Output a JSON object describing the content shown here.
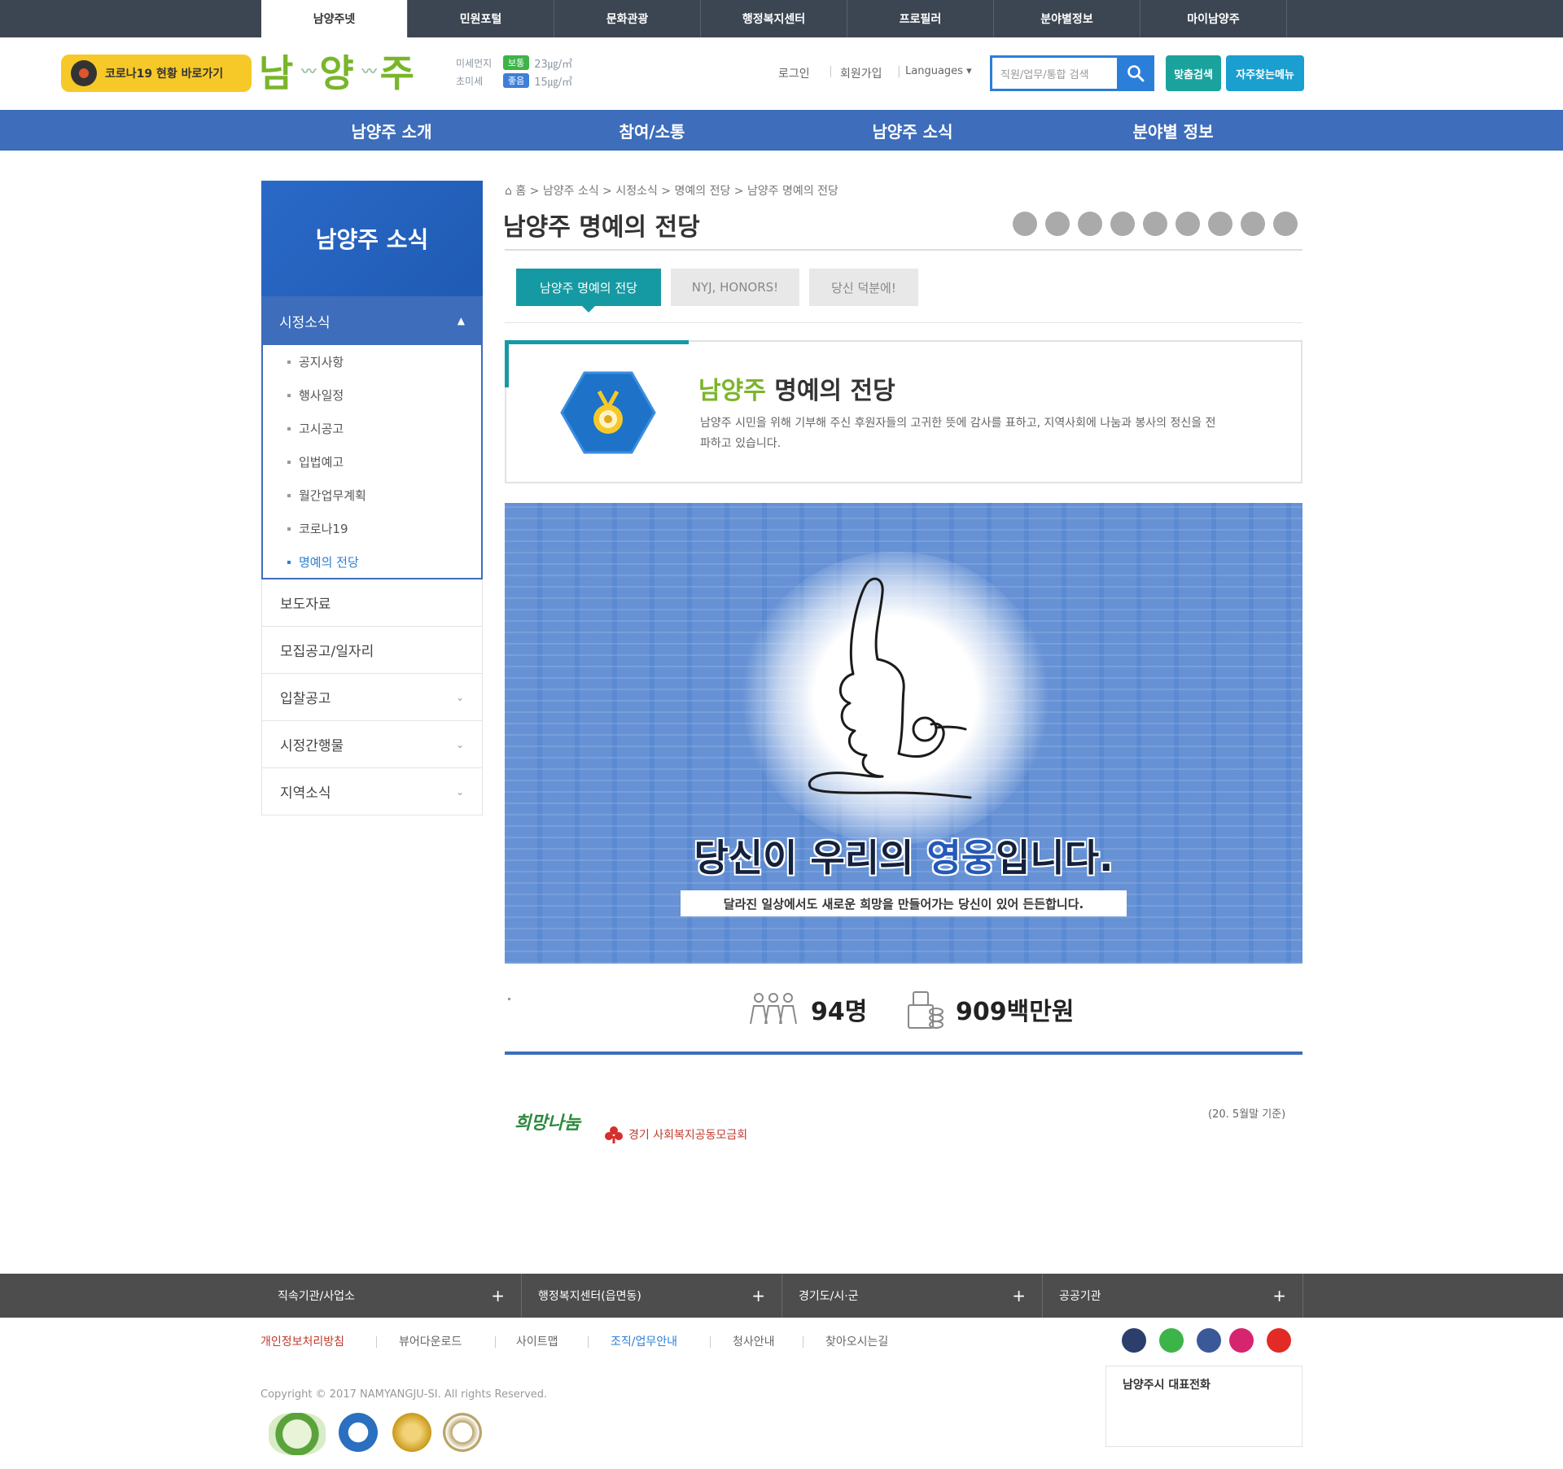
{
  "top_tabs": [
    "남양주넷",
    "민원포털",
    "문화관광",
    "행정복지센터",
    "프로필러",
    "분야별정보",
    "마이남양주"
  ],
  "header": {
    "covid_button": "코로나19 현황 바로가기",
    "logo_text": [
      "남",
      "양",
      "주"
    ],
    "air": [
      {
        "label": "미세먼지",
        "badge": "보통",
        "badge_color": "#3db44a",
        "value": "23㎍/㎥"
      },
      {
        "label": "초미세",
        "badge": "좋음",
        "badge_color": "#3d7fd8",
        "value": "15㎍/㎥"
      }
    ],
    "login": "로그인",
    "join": "회원가입",
    "languages": "Languages",
    "search_placeholder": "직원/업무/통합 검색",
    "btn_org": "맞춤검색",
    "btn_menu": "자주찾는메뉴"
  },
  "main_nav": [
    "남양주 소개",
    "참여/소통",
    "남양주 소식",
    "분야별 정보"
  ],
  "sidebar": {
    "title": "남양주 소식",
    "selected": "시정소식",
    "sub_items": [
      "공지사항",
      "행사일정",
      "고시공고",
      "입법예고",
      "월간업무계획",
      "코로나19",
      "명예의 전당"
    ],
    "menus": [
      {
        "label": "보도자료",
        "has_arrow": false
      },
      {
        "label": "모집공고/일자리",
        "has_arrow": false
      },
      {
        "label": "입찰공고",
        "has_arrow": true
      },
      {
        "label": "시정간행물",
        "has_arrow": true
      },
      {
        "label": "지역소식",
        "has_arrow": true
      }
    ]
  },
  "breadcrumb": "홈 > 남양주 소식 > 시정소식 > 명예의 전당 > 남양주 명예의 전당",
  "page_title": "남양주 명예의 전당",
  "tabs": [
    "남양주 명예의 전당",
    "NYJ, HONORS!",
    "당신 덕분에!"
  ],
  "intro": {
    "title_green": "남양주",
    "title_rest": " 명예의 전당",
    "description": "남양주 시민을 위해 기부해 주신 후원자들의 고귀한 뜻에 감사를 표하고, 지역사회에 나눔과 봉사의 정신을 전파하고 있습니다."
  },
  "banner": {
    "main_pre": "당신이 우리의 ",
    "main_hero": "영웅",
    "main_post": "입니다.",
    "sub": "달라진 일상에서도 새로운 희망을 만들어가는 당신이 있어 든든합니다."
  },
  "stats": {
    "people": "94명",
    "amount": "909백만원"
  },
  "partners": {
    "p1": "희망나눔",
    "p2": "경기 사회복지공동모금회"
  },
  "basis": "(20. 5월말 기준)",
  "footer": {
    "bar": [
      "직속기관/사업소",
      "행정복지센터(읍면동)",
      "경기도/시·군",
      "공공기관"
    ],
    "links": [
      {
        "label": "개인정보처리방침",
        "style": "red"
      },
      {
        "label": "뷰어다운로드",
        "style": ""
      },
      {
        "label": "사이트맵",
        "style": ""
      },
      {
        "label": "조직/업무안내",
        "style": "blue"
      },
      {
        "label": "청사안내",
        "style": ""
      },
      {
        "label": "찾아오시는길",
        "style": ""
      }
    ],
    "copyright": "Copyright © 2017 NAMYANGJU-SI. All rights Reserved.",
    "phone_title": "남양주시 대표전화",
    "sns_colors": [
      "#2c3e6b",
      "#3db44a",
      "#3b5998",
      "#d6246e",
      "#e22b26"
    ]
  }
}
